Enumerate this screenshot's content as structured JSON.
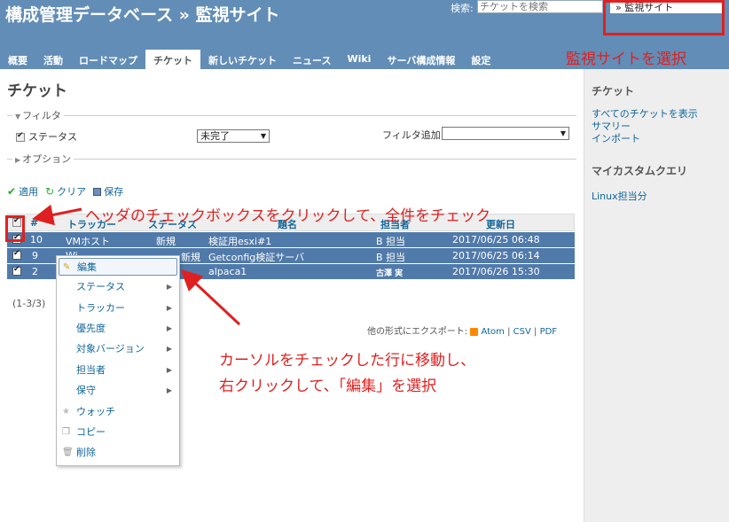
{
  "header": {
    "title": "構成管理データベース » 監視サイト",
    "search_label": "検索:",
    "search_placeholder": "チケットを検索",
    "project_jump": "» 監視サイト"
  },
  "tabs": [
    {
      "label": "概要"
    },
    {
      "label": "活動"
    },
    {
      "label": "ロードマップ"
    },
    {
      "label": "チケット",
      "active": true
    },
    {
      "label": "新しいチケット"
    },
    {
      "label": "ニュース"
    },
    {
      "label": "Wiki"
    },
    {
      "label": "サーバ構成情報"
    },
    {
      "label": "設定"
    }
  ],
  "main": {
    "title": "チケット",
    "filter_legend": "フィルタ",
    "status_label": "ステータス",
    "status_value": "未完了",
    "add_filter_label": "フィルタ追加",
    "options_legend": "オプション",
    "actions": {
      "apply": "適用",
      "clear": "クリア",
      "save": "保存"
    },
    "table": {
      "headers": {
        "id": "#",
        "tracker": "トラッカー",
        "status": "ステータス",
        "subject": "題名",
        "assignee": "担当者",
        "updated": "更新日"
      },
      "rows": [
        {
          "id": "10",
          "tracker": "VMホスト",
          "status": "新規",
          "subject": "検証用esxi#1",
          "assignee": "B 担当",
          "updated": "2017/06/25 06:48"
        },
        {
          "id": "9",
          "tracker": "Wi...",
          "status": "新規",
          "subject": "Getconfig検証サーバ",
          "assignee": "B 担当",
          "updated": "2017/06/25 06:14"
        },
        {
          "id": "2",
          "tracker": "",
          "status": "",
          "subject": "alpaca1",
          "assignee": "古澤 実",
          "updated": "2017/06/26 15:30"
        }
      ]
    },
    "pagination": "(1-3/3)",
    "export": {
      "label": "他の形式にエクスポート:",
      "atom": "Atom",
      "csv": "CSV",
      "pdf": "PDF",
      "sep": "|"
    }
  },
  "context_menu": {
    "items": [
      {
        "label": "編集",
        "icon": "pencil-icon",
        "highlight": true
      },
      {
        "label": "ステータス",
        "submenu": true
      },
      {
        "label": "トラッカー",
        "submenu": true
      },
      {
        "label": "優先度",
        "submenu": true
      },
      {
        "label": "対象バージョン",
        "submenu": true
      },
      {
        "label": "担当者",
        "submenu": true
      },
      {
        "label": "保守",
        "submenu": true
      },
      {
        "label": "ウォッチ",
        "icon": "star-icon"
      },
      {
        "label": "コピー",
        "icon": "copy-icon"
      },
      {
        "label": "削除",
        "icon": "trash-icon"
      }
    ]
  },
  "sidebar": {
    "heading1": "チケット",
    "links": [
      "すべてのチケットを表示",
      "サマリー",
      "インポート"
    ],
    "heading2": "マイカスタムクエリ",
    "query": "Linux担当分"
  },
  "annotations": {
    "select_site": "監視サイトを選択",
    "check_all": "ヘッダのチェックボックスをクリックして、全件をチェック",
    "edit_line1": "カーソルをチェックした行に移動し、",
    "edit_line2": "右クリックして、「編集」を選択"
  },
  "colors": {
    "header": "#628db6",
    "selected_row": "#507aaa",
    "link": "#116699",
    "annotation": "#e02020"
  }
}
